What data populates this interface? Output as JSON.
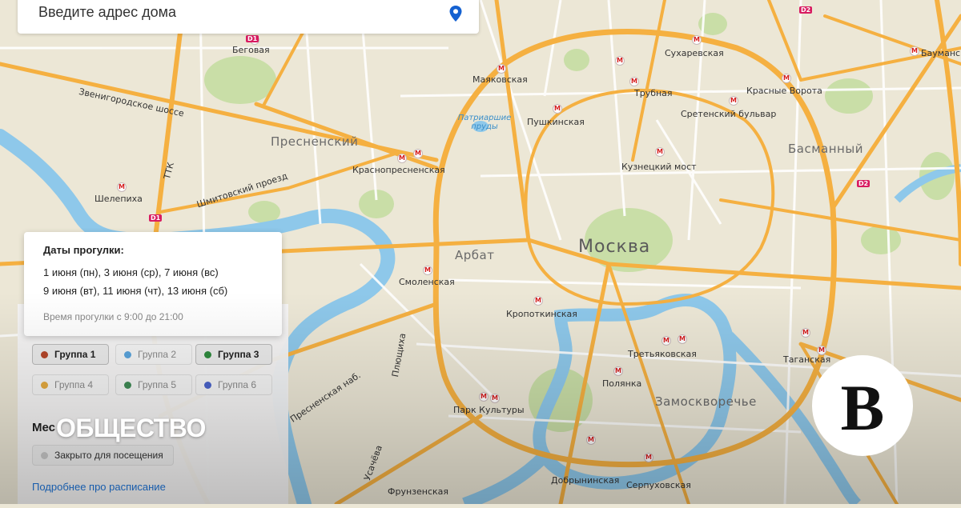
{
  "search": {
    "placeholder": "Введите адрес дома"
  },
  "map": {
    "city_label": "Москва",
    "districts": [
      "Пресненский",
      "Арбат",
      "Басманный",
      "Замоскворечье"
    ],
    "stations": [
      "Беговая",
      "Маяковская",
      "Сухаревская",
      "Трубная",
      "Красные Ворота",
      "Сретенский бульвар",
      "Пушкинская",
      "Краснопресненская",
      "Кузнецкий мост",
      "Шелепиха",
      "Смоленская",
      "Кропоткинская",
      "Третьяковская",
      "Полянка",
      "Таганская",
      "Парк Культуры",
      "Серпуховская",
      "Фрунзенская",
      "Бауманская",
      "Добрынинская"
    ],
    "streets": [
      "Звенигородское шоссе",
      "Шмитовский проезд",
      "Плющиха",
      "Усачёва",
      "Пресненская наб.",
      "ТТК"
    ],
    "water": [
      "Патриаршие пруды"
    ],
    "route_badges": [
      "D1",
      "D2"
    ]
  },
  "schedule": {
    "title": "Даты прогулки:",
    "dates_line1": "1 июня (пн), 3 июня (ср), 7 июня (вс)",
    "dates_line2": "9 июня (вт), 11 июня (чт), 13 июня (сб)",
    "time": "Время прогулки с 9:00 до 21:00"
  },
  "groups": [
    {
      "label": "Группа 1",
      "color": "#b4472a",
      "active": true
    },
    {
      "label": "Группа 2",
      "color": "#5aa3db",
      "active": false
    },
    {
      "label": "Группа 3",
      "color": "#2f8a3e",
      "active": true
    },
    {
      "label": "Группа 4",
      "color": "#e3a940",
      "active": false
    },
    {
      "label": "Группа 5",
      "color": "#3f8a55",
      "active": false
    },
    {
      "label": "Группа 6",
      "color": "#4a63c9",
      "active": false
    }
  ],
  "places": {
    "heading": "Мес",
    "closed_label": "Закрыто для посещения",
    "more_link": "Подробнее про расписание"
  },
  "overlay": {
    "category": "ОБЩЕСТВО",
    "logo_letter": "В"
  },
  "colors": {
    "road": "#f5b041",
    "water": "#8ec8ea",
    "park": "#c9dea7",
    "land": "#ece7d6",
    "accent_link": "#1e73d6",
    "metro_red": "#d61f1f"
  }
}
